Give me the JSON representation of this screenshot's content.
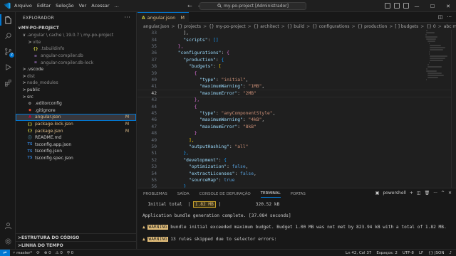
{
  "titlebar": {
    "menu": [
      "Arquivo",
      "Editar",
      "Seleção",
      "Ver",
      "Acessar",
      "..."
    ],
    "nav_back": "←",
    "nav_forward": "→",
    "search_text": "my-po-project [Administrador]"
  },
  "activitybar": {
    "scm_badge": "2"
  },
  "sidebar": {
    "header": "EXPLORADOR",
    "more": "···",
    "root": "MY-PO-PROJECT",
    "items": [
      {
        "indent": 1,
        "chev": "∨",
        "icon": "",
        "label": ".angular \\ cache \\ 19.0.7 \\ my-po-project",
        "deco": "",
        "dim": true
      },
      {
        "indent": 2,
        "chev": ">",
        "icon": "",
        "label": "vite",
        "deco": "",
        "dim": true
      },
      {
        "indent": 2,
        "chev": "",
        "icon": "{}",
        "label": ".tsbuildinfo",
        "deco": "",
        "dim": true
      },
      {
        "indent": 2,
        "chev": "",
        "icon": "≡",
        "label": "angular-compiler.db",
        "deco": "",
        "dim": true
      },
      {
        "indent": 2,
        "chev": "",
        "icon": "≡",
        "label": "angular-compiler.db-lock",
        "deco": "",
        "dim": true
      },
      {
        "indent": 1,
        "chev": ">",
        "icon": "",
        "label": ".vscode",
        "deco": ""
      },
      {
        "indent": 1,
        "chev": ">",
        "icon": "",
        "label": "dist",
        "deco": "",
        "dim": true
      },
      {
        "indent": 1,
        "chev": ">",
        "icon": "",
        "label": "node_modules",
        "deco": "",
        "dim": true
      },
      {
        "indent": 1,
        "chev": ">",
        "icon": "",
        "label": "public",
        "deco": ""
      },
      {
        "indent": 1,
        "chev": ">",
        "icon": "",
        "label": "src",
        "deco": ""
      },
      {
        "indent": 1,
        "chev": "",
        "icon": "⚙",
        "label": ".editorconfig",
        "deco": ""
      },
      {
        "indent": 1,
        "chev": "",
        "icon": "◆",
        "label": ".gitignore",
        "deco": ""
      },
      {
        "indent": 1,
        "chev": "",
        "icon": "A",
        "label": "angular.json",
        "deco": "M",
        "selected": true
      },
      {
        "indent": 1,
        "chev": "",
        "icon": "{}",
        "label": "package-lock.json",
        "deco": "M",
        "modified": true
      },
      {
        "indent": 1,
        "chev": "",
        "icon": "{}",
        "label": "package.json",
        "deco": "M",
        "modified": true
      },
      {
        "indent": 1,
        "chev": "",
        "icon": "ⓘ",
        "label": "README.md",
        "deco": ""
      },
      {
        "indent": 1,
        "chev": "",
        "icon": "TS",
        "label": "tsconfig.app.json",
        "deco": ""
      },
      {
        "indent": 1,
        "chev": "",
        "icon": "TS",
        "label": "tsconfig.json",
        "deco": ""
      },
      {
        "indent": 1,
        "chev": "",
        "icon": "TS",
        "label": "tsconfig.spec.json",
        "deco": ""
      }
    ],
    "outline": "ESTRUTURA DO CÓDIGO",
    "timeline": "LINHA DO TEMPO"
  },
  "tabs": {
    "active_icon": "A",
    "active_label": "angular.json",
    "active_mod": "M"
  },
  "breadcrumb": [
    "angular.json",
    "{} projects",
    "{} my-po-project",
    "{} architect",
    "{} build",
    "{} configurations",
    "{} production",
    "[ ] budgets",
    "{} 0",
    "abc maximumError"
  ],
  "editor": {
    "current_line": 42,
    "lines": [
      {
        "n": 33,
        "indent": 8,
        "tokens": [
          [
            "pun",
            "],"
          ]
        ]
      },
      {
        "n": 34,
        "indent": 8,
        "tokens": [
          [
            "key",
            "\"scripts\""
          ],
          [
            "pun",
            ": "
          ],
          [
            "br3",
            "[]"
          ]
        ]
      },
      {
        "n": 35,
        "indent": 6,
        "tokens": [
          [
            "br2",
            "},"
          ]
        ]
      },
      {
        "n": 36,
        "indent": 6,
        "tokens": [
          [
            "key",
            "\"configurations\""
          ],
          [
            "pun",
            ": "
          ],
          [
            "br2",
            "{"
          ]
        ]
      },
      {
        "n": 37,
        "indent": 8,
        "tokens": [
          [
            "key",
            "\"production\""
          ],
          [
            "pun",
            ": "
          ],
          [
            "br3",
            "{"
          ]
        ]
      },
      {
        "n": 38,
        "indent": 10,
        "tokens": [
          [
            "key",
            "\"budgets\""
          ],
          [
            "pun",
            ": "
          ],
          [
            "br1",
            "["
          ]
        ]
      },
      {
        "n": 39,
        "indent": 12,
        "tokens": [
          [
            "br2",
            "{"
          ]
        ]
      },
      {
        "n": 40,
        "indent": 14,
        "tokens": [
          [
            "key",
            "\"type\""
          ],
          [
            "pun",
            ": "
          ],
          [
            "str",
            "\"initial\""
          ],
          [
            "pun",
            ","
          ]
        ]
      },
      {
        "n": 41,
        "indent": 14,
        "tokens": [
          [
            "key",
            "\"maximumWarning\""
          ],
          [
            "pun",
            ": "
          ],
          [
            "str",
            "\"1MB\""
          ],
          [
            "pun",
            ","
          ]
        ]
      },
      {
        "n": 42,
        "indent": 14,
        "tokens": [
          [
            "key",
            "\"maximumError\""
          ],
          [
            "pun",
            ": "
          ],
          [
            "str",
            "\"2MB\""
          ]
        ]
      },
      {
        "n": 43,
        "indent": 12,
        "tokens": [
          [
            "br2",
            "},"
          ]
        ]
      },
      {
        "n": 44,
        "indent": 12,
        "tokens": [
          [
            "br2",
            "{"
          ]
        ]
      },
      {
        "n": 45,
        "indent": 14,
        "tokens": [
          [
            "key",
            "\"type\""
          ],
          [
            "pun",
            ": "
          ],
          [
            "str",
            "\"anyComponentStyle\""
          ],
          [
            "pun",
            ","
          ]
        ]
      },
      {
        "n": 46,
        "indent": 14,
        "tokens": [
          [
            "key",
            "\"maximumWarning\""
          ],
          [
            "pun",
            ": "
          ],
          [
            "str",
            "\"4kB\""
          ],
          [
            "pun",
            ","
          ]
        ]
      },
      {
        "n": 47,
        "indent": 14,
        "tokens": [
          [
            "key",
            "\"maximumError\""
          ],
          [
            "pun",
            ": "
          ],
          [
            "str",
            "\"8kB\""
          ]
        ]
      },
      {
        "n": 48,
        "indent": 12,
        "tokens": [
          [
            "br2",
            "}"
          ]
        ]
      },
      {
        "n": 49,
        "indent": 10,
        "tokens": [
          [
            "br1",
            "],"
          ]
        ]
      },
      {
        "n": 50,
        "indent": 10,
        "tokens": [
          [
            "key",
            "\"outputHashing\""
          ],
          [
            "pun",
            ": "
          ],
          [
            "str",
            "\"all\""
          ]
        ]
      },
      {
        "n": 51,
        "indent": 8,
        "tokens": [
          [
            "br3",
            "},"
          ]
        ]
      },
      {
        "n": 52,
        "indent": 8,
        "tokens": [
          [
            "key",
            "\"development\""
          ],
          [
            "pun",
            ": "
          ],
          [
            "br3",
            "{"
          ]
        ]
      },
      {
        "n": 53,
        "indent": 10,
        "tokens": [
          [
            "key",
            "\"optimization\""
          ],
          [
            "pun",
            ": "
          ],
          [
            "kw",
            "false"
          ],
          [
            "pun",
            ","
          ]
        ]
      },
      {
        "n": 54,
        "indent": 10,
        "tokens": [
          [
            "key",
            "\"extractLicenses\""
          ],
          [
            "pun",
            ": "
          ],
          [
            "kw",
            "false"
          ],
          [
            "pun",
            ","
          ]
        ]
      },
      {
        "n": 55,
        "indent": 10,
        "tokens": [
          [
            "key",
            "\"sourceMap\""
          ],
          [
            "pun",
            ": "
          ],
          [
            "kw",
            "true"
          ]
        ]
      },
      {
        "n": 56,
        "indent": 8,
        "tokens": [
          [
            "br3",
            "}"
          ]
        ]
      }
    ]
  },
  "panel": {
    "tabs": [
      "PROBLEMAS",
      "SAÍDA",
      "CONSOLE DE DEPURAÇÃO",
      "TERMINAL",
      "PORTAS"
    ],
    "active_tab": "TERMINAL",
    "shell": "powershell",
    "terminal": {
      "total_label": "Initial total",
      "total_value": "1.82 MB",
      "total_size": "320.52 kB",
      "gen_complete": "Application bundle generation complete. [37.084 seconds]",
      "warn_label": "WARNING",
      "warn1": "bundle initial exceeded maximum budget. Budget 1.00 MB was not met by 823.94 kB with a total of 1.82 MB.",
      "warn2": "13 rules skipped due to selector errors:"
    }
  },
  "statusbar": {
    "branch": "master*",
    "sync": "⟳",
    "errors": "⊗ 0",
    "warnings": "⚠ 0",
    "ports": "⚲ 0",
    "position": "Ln 42, Col 37",
    "spaces": "Espaços: 2",
    "encoding": "UTF-8",
    "eol": "LF",
    "language": "{} JSON",
    "bell": "🔔"
  }
}
